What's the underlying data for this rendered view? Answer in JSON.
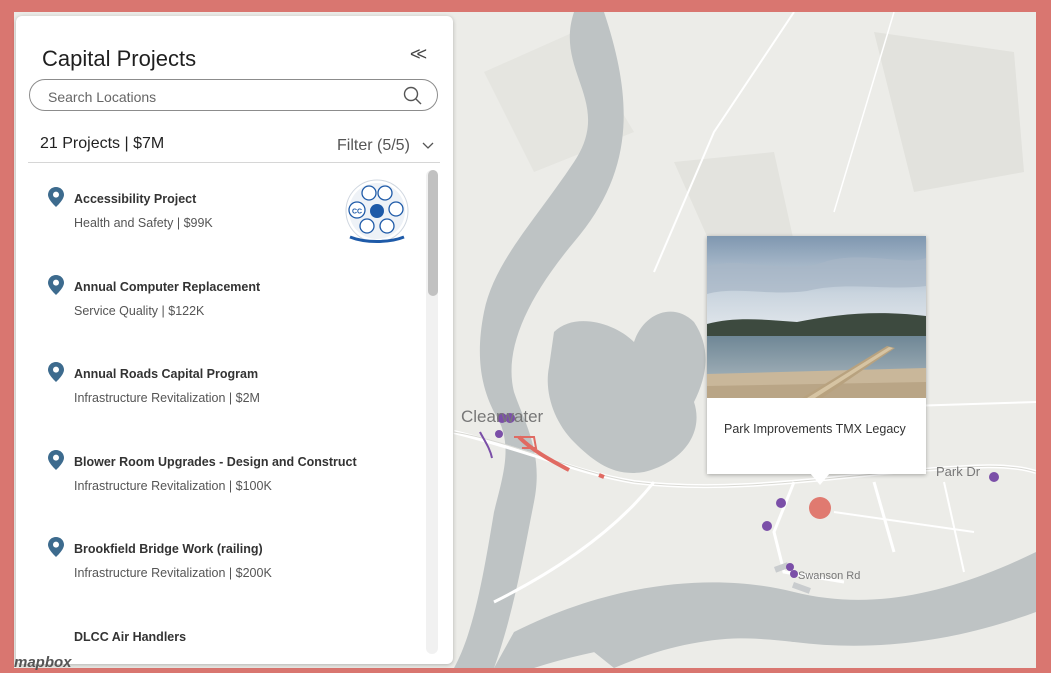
{
  "sidebar": {
    "title": "Capital Projects",
    "collapse_label": "<<",
    "search": {
      "placeholder": "Search Locations",
      "value": ""
    },
    "summary": "21 Projects | $7M",
    "filter_label": "Filter (5/5)",
    "projects": [
      {
        "name": "Accessibility Project",
        "details": "Health and Safety | $99K"
      },
      {
        "name": "Annual Computer Replacement",
        "details": "Service Quality | $122K"
      },
      {
        "name": "Annual Roads Capital Program",
        "details": "Infrastructure Revitalization | $2M"
      },
      {
        "name": "Blower Room Upgrades - Design and Construct",
        "details": "Infrastructure Revitalization | $100K"
      },
      {
        "name": "Brookfield Bridge Work (railing)",
        "details": "Infrastructure Revitalization | $200K"
      },
      {
        "name": "DLCC Air Handlers",
        "details": ""
      }
    ],
    "badge_text": "CC"
  },
  "popup": {
    "title": "Park Improvements TMX Legacy"
  },
  "map": {
    "labels": {
      "town": "Clearwater",
      "road1": "Park Dr",
      "road2": "Swanson Rd"
    },
    "attribution": "mapbox"
  },
  "colors": {
    "accent_frame": "#d97670",
    "pin": "#3d6b8e",
    "project_point": "#7b4fa8",
    "project_line": "#e06a62",
    "water": "#bec3c4",
    "land": "#ecece8"
  }
}
